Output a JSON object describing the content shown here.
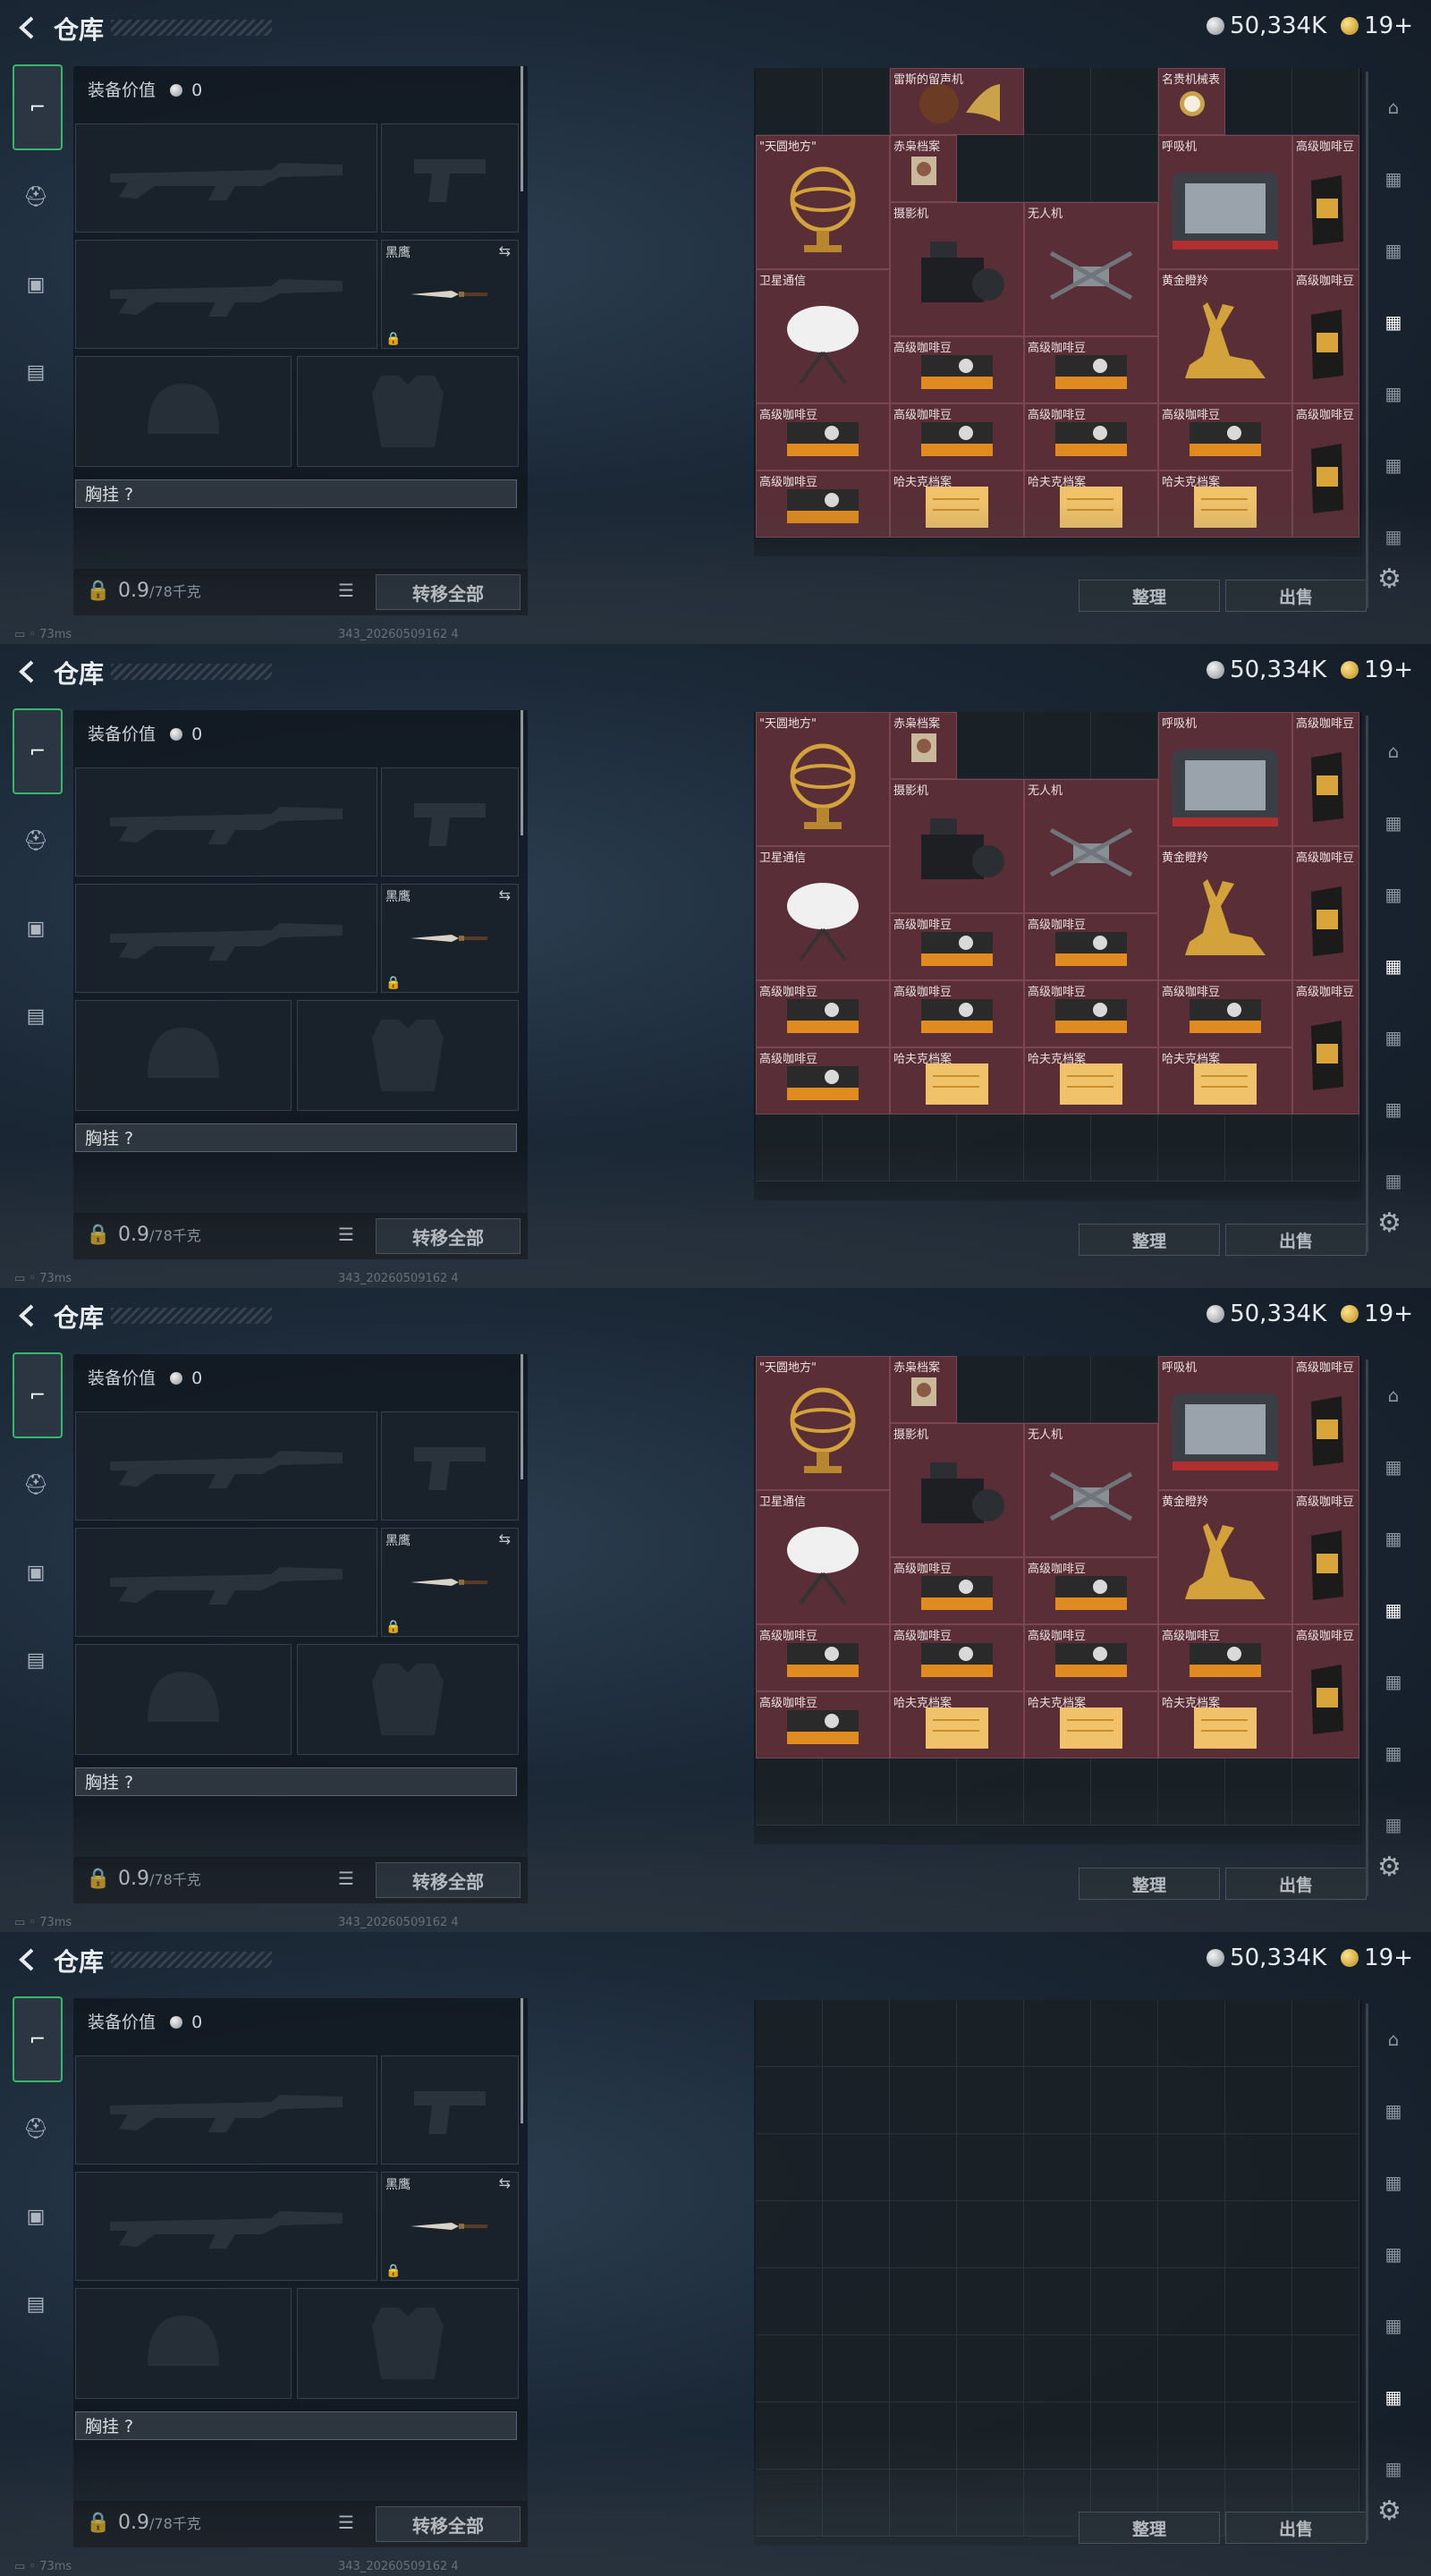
{
  "header": {
    "title": "仓库",
    "currency_silver": "50,334K",
    "currency_gold": "19+"
  },
  "equipment": {
    "value_label": "装备价值",
    "value_amount": "0",
    "knife_name": "黑鹰",
    "rig_label": "胸挂 ?",
    "weight_value": "0.9",
    "weight_max": "/78千克",
    "transfer_all": "转移全部"
  },
  "status": {
    "ping": "73ms",
    "build": "343_20260509162 4"
  },
  "stash_items": [
    {
      "name": "雷斯的留声机"
    },
    {
      "name": "名贵机械表"
    },
    {
      "name": "\"天圆地方\""
    },
    {
      "name": "赤枭档案"
    },
    {
      "name": "呼吸机"
    },
    {
      "name": "高级咖啡豆"
    },
    {
      "name": "摄影机"
    },
    {
      "name": "无人机"
    },
    {
      "name": "卫星通信"
    },
    {
      "name": "黄金瞪羚"
    },
    {
      "name": "哈夫克档案"
    }
  ],
  "actions": {
    "sort": "整理",
    "sell": "出售"
  },
  "colors": {
    "accent_green": "#35b86a",
    "item_red": "#5a2e36"
  }
}
